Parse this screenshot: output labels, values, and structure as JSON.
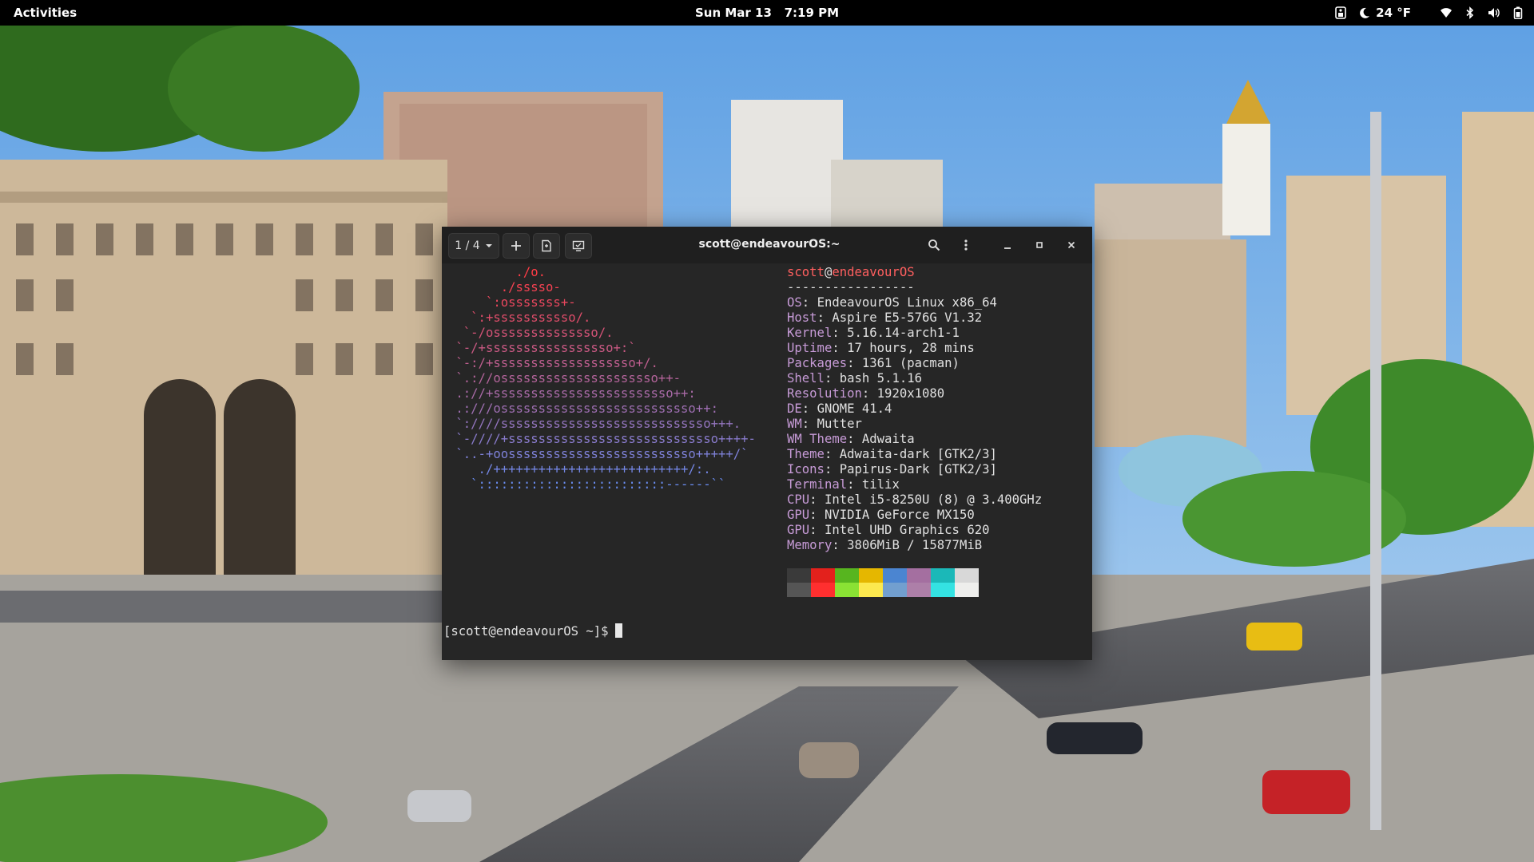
{
  "topbar": {
    "activities": "Activities",
    "date": "Sun Mar 13",
    "time": "7:19 PM",
    "weather": "24 °F",
    "icons": [
      "accessibility-icon",
      "weather-moon-icon",
      "wifi-icon",
      "bluetooth-icon",
      "volume-icon",
      "battery-icon"
    ]
  },
  "terminal": {
    "session": "1 / 4",
    "title": "scott@endeavourOS:~",
    "logo_lines": [
      "         ./o.",
      "       ./sssso-",
      "     `:osssssss+-",
      "   `:+sssssssssso/.",
      "  `-/ossssssssssssso/.",
      " `-/+sssssssssssssssso+:`",
      " `-:/+sssssssssssssssssso+/.",
      " `.://osssssssssssssssssssso++-",
      " .://+ssssssssssssssssssssssso++:",
      " .:///ossssssssssssssssssssssssso++:",
      " `:////ssssssssssssssssssssssssssso+++.",
      " `-////+ssssssssssssssssssssssssssso++++-",
      " `..-+oosssssssssssssssssssssssso+++++/`",
      "    ./++++++++++++++++++++++++++/:.",
      "   `:::::::::::::::::::::::::------``"
    ],
    "user": "scott",
    "host": "endeavourOS",
    "separator": "-----------------",
    "info": [
      {
        "key": "OS",
        "value": "EndeavourOS Linux x86_64"
      },
      {
        "key": "Host",
        "value": "Aspire E5-576G V1.32"
      },
      {
        "key": "Kernel",
        "value": "5.16.14-arch1-1"
      },
      {
        "key": "Uptime",
        "value": "17 hours, 28 mins"
      },
      {
        "key": "Packages",
        "value": "1361 (pacman)"
      },
      {
        "key": "Shell",
        "value": "bash 5.1.16"
      },
      {
        "key": "Resolution",
        "value": "1920x1080"
      },
      {
        "key": "DE",
        "value": "GNOME 41.4"
      },
      {
        "key": "WM",
        "value": "Mutter"
      },
      {
        "key": "WM Theme",
        "value": "Adwaita"
      },
      {
        "key": "Theme",
        "value": "Adwaita-dark [GTK2/3]"
      },
      {
        "key": "Icons",
        "value": "Papirus-Dark [GTK2/3]"
      },
      {
        "key": "Terminal",
        "value": "tilix"
      },
      {
        "key": "CPU",
        "value": "Intel i5-8250U (8) @ 3.400GHz"
      },
      {
        "key": "GPU",
        "value": "NVIDIA GeForce MX150"
      },
      {
        "key": "GPU",
        "value": "Intel UHD Graphics 620"
      },
      {
        "key": "Memory",
        "value": "3806MiB / 15877MiB"
      }
    ],
    "palette_top": [
      "#3a3a3a",
      "#e3211c",
      "#57b51f",
      "#e5b700",
      "#4b85d1",
      "#a46fa0",
      "#1bb8b8",
      "#d8d8d8"
    ],
    "palette_bottom": [
      "#555555",
      "#ff2f2f",
      "#8ae234",
      "#fce94f",
      "#729fcf",
      "#ad7fa8",
      "#34e2e2",
      "#eeeeec"
    ],
    "prompt": "[scott@endeavourOS ~]$"
  }
}
